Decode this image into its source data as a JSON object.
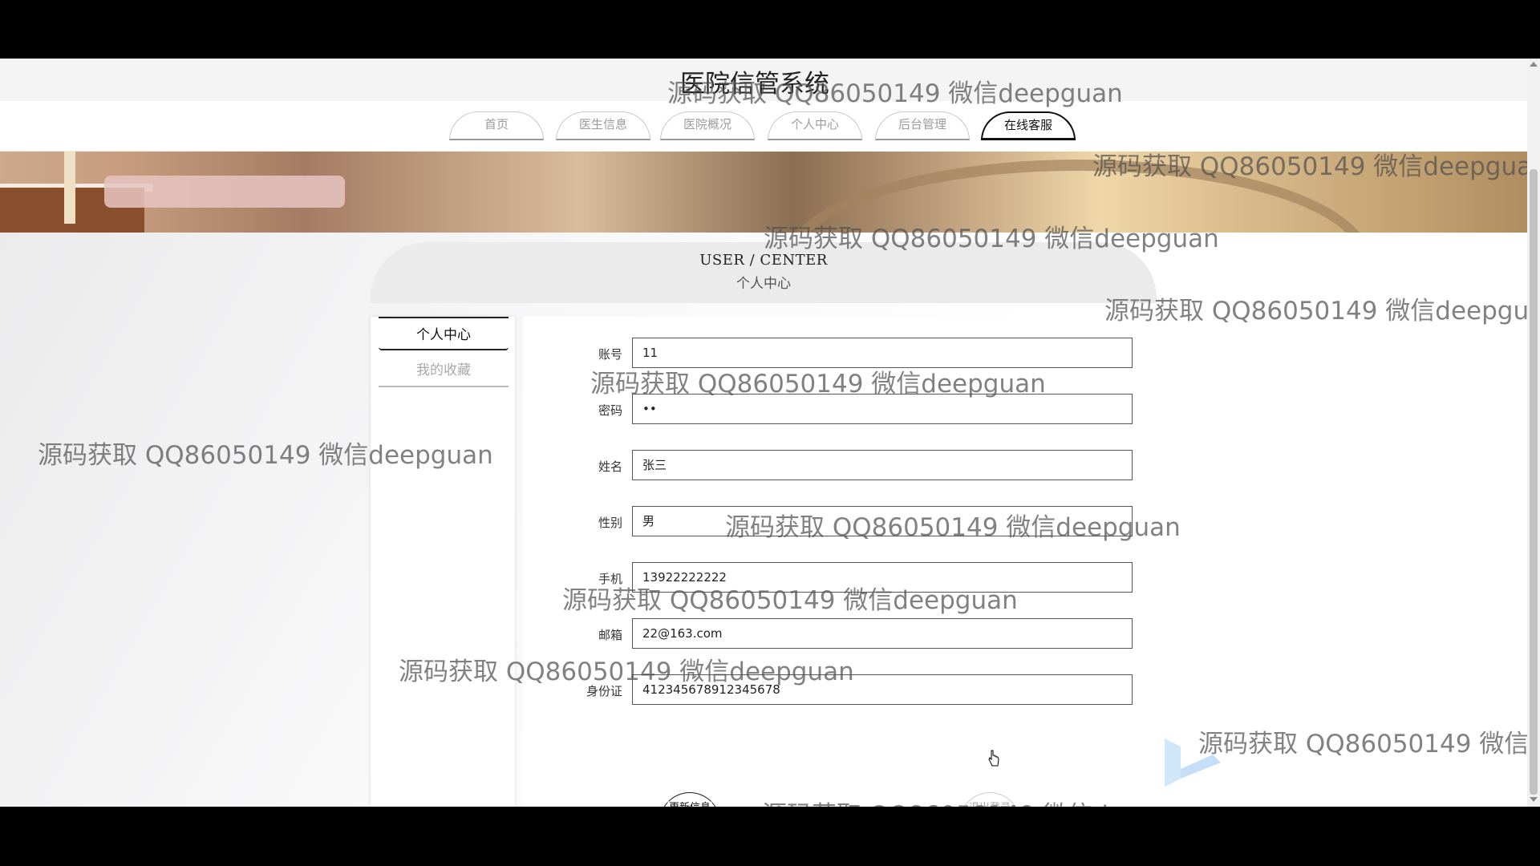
{
  "site": {
    "title": "医院信管系统"
  },
  "nav": {
    "tabs": [
      {
        "label": "首页"
      },
      {
        "label": "医生信息"
      },
      {
        "label": "医院概况"
      },
      {
        "label": "个人中心"
      },
      {
        "label": "后台管理"
      },
      {
        "label": "在线客服",
        "active": true
      }
    ]
  },
  "user_center": {
    "title_en": "USER / CENTER",
    "title_cn": "个人中心"
  },
  "side_menu": {
    "items": [
      {
        "label": "个人中心",
        "active": true
      },
      {
        "label": "我的收藏"
      }
    ]
  },
  "form": {
    "fields": [
      {
        "label": "账号",
        "value": "11"
      },
      {
        "label": "密码",
        "value": "••"
      },
      {
        "label": "姓名",
        "value": "张三"
      },
      {
        "label": "性别",
        "value": "男"
      },
      {
        "label": "手机",
        "value": "13922222222"
      },
      {
        "label": "邮箱",
        "value": "22@163.com"
      },
      {
        "label": "身份证",
        "value": "412345678912345678"
      }
    ],
    "update_button": "更新信息",
    "logout_button": "退出登录"
  },
  "watermark": {
    "text": "源码获取 QQ86050149 微信deepguan"
  }
}
